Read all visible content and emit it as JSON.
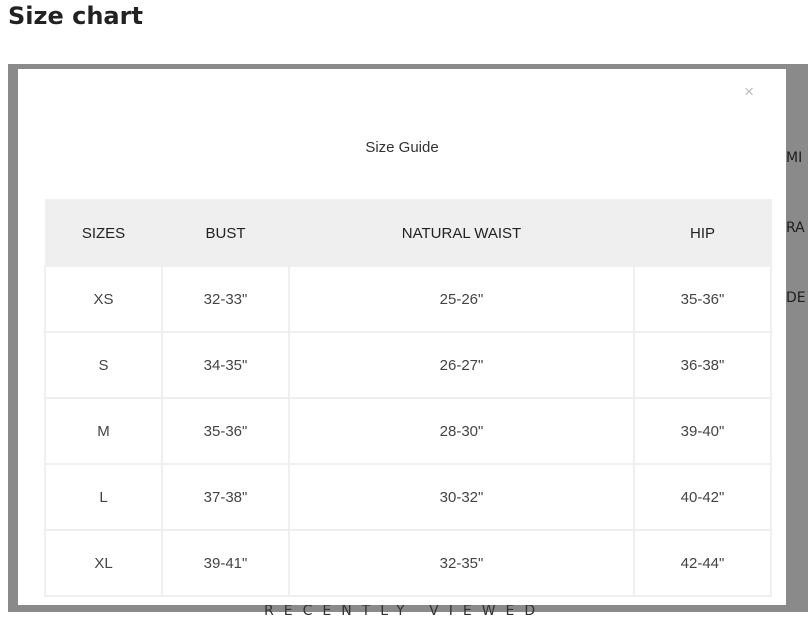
{
  "page": {
    "heading": "Size chart"
  },
  "background": {
    "right_letters": [
      "MI",
      "RA",
      "DE"
    ],
    "recent_label": "RECENTLY VIEWED"
  },
  "modal": {
    "close_glyph": "×",
    "title": "Size Guide",
    "table": {
      "headers": [
        "SIZES",
        "BUST",
        "NATURAL WAIST",
        "HIP"
      ],
      "rows": [
        [
          "XS",
          "32-33\"",
          "25-26\"",
          "35-36\""
        ],
        [
          "S",
          "34-35\"",
          "26-27\"",
          "36-38\""
        ],
        [
          "M",
          "35-36\"",
          "28-30\"",
          "39-40\""
        ],
        [
          "L",
          "37-38\"",
          "30-32\"",
          "40-42\""
        ],
        [
          "XL",
          "39-41\"",
          "32-35\"",
          "42-44\""
        ]
      ]
    }
  },
  "colors": {
    "overlay": "#8a8a8a",
    "header_row_bg": "#efefef",
    "text": "#222222"
  }
}
